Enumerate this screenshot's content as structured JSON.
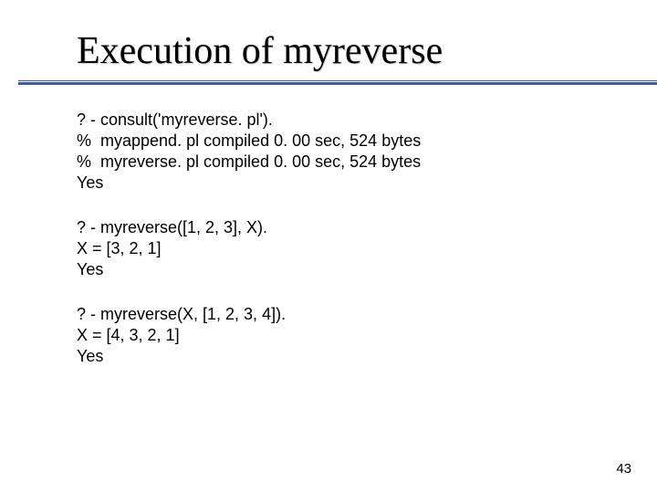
{
  "slide": {
    "title": "Execution of myreverse",
    "blocks": [
      {
        "lines": [
          "? - consult('myreverse. pl').",
          "%  myappend. pl compiled 0. 00 sec, 524 bytes",
          "%  myreverse. pl compiled 0. 00 sec, 524 bytes",
          "Yes"
        ]
      },
      {
        "lines": [
          "? - myreverse([1, 2, 3], X).",
          "X = [3, 2, 1]",
          "Yes"
        ]
      },
      {
        "lines": [
          "? - myreverse(X, [1, 2, 3, 4]).",
          "X = [4, 3, 2, 1]",
          "Yes"
        ]
      }
    ],
    "page_number": "43"
  }
}
